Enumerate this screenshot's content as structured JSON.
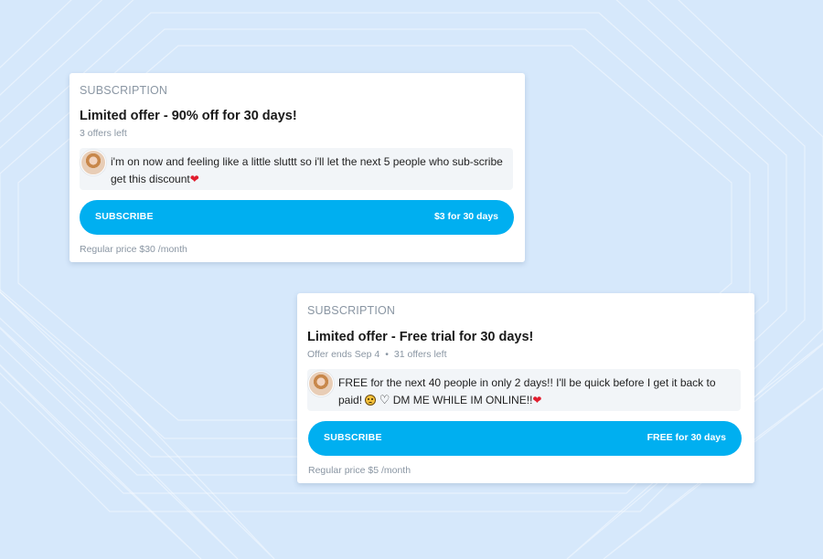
{
  "colors": {
    "background": "#d6e8fb",
    "accent": "#00aff0",
    "muted_text": "#8a96a3",
    "heart": "#e11d2e"
  },
  "cards": [
    {
      "header": "SUBSCRIPTION",
      "title": "Limited offer - 90% off for 30 days!",
      "meta": "3 offers left",
      "message": "i'm on now and feeling like a little sluttt so i'll let the next 5 people who sub-scribe get this discount",
      "message_icons": [
        "red-heart-icon"
      ],
      "button_label": "SUBSCRIBE",
      "button_price": "$3 for 30 days",
      "regular_price": "Regular price $30 /month"
    },
    {
      "header": "SUBSCRIPTION",
      "title": "Limited offer - Free trial for 30 days!",
      "meta_ends": "Offer ends Sep 4",
      "meta_separator": "•",
      "meta_left": "31 offers left",
      "message_part1": "FREE for the next 40 people in only 2 days!! I'll be quick before I get it back to paid!",
      "message_part2": "DM ME WHILE IM ONLINE!!",
      "message_icons": [
        "frowning-face-icon",
        "white-heart-icon",
        "red-heart-icon"
      ],
      "button_label": "SUBSCRIBE",
      "button_price": "FREE for 30 days",
      "regular_price": "Regular price $5 /month"
    }
  ]
}
